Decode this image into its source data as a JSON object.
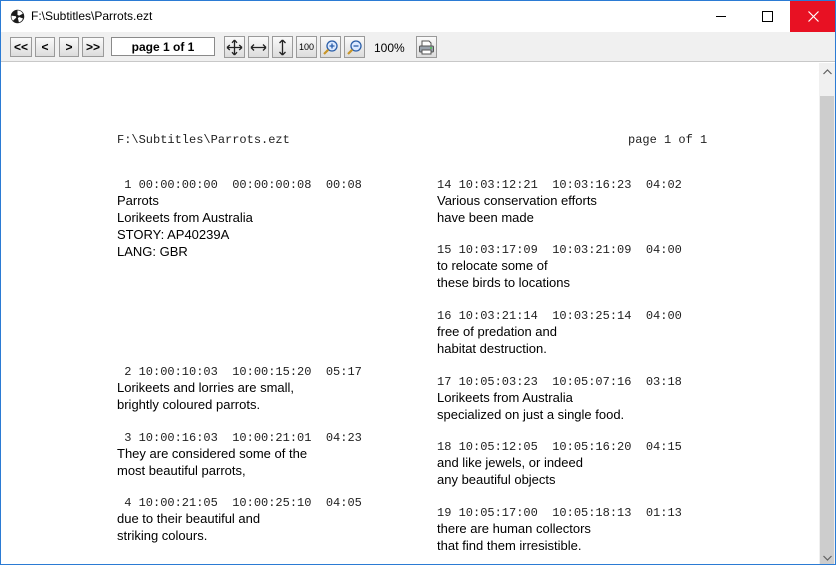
{
  "window": {
    "title": "F:\\Subtitles\\Parrots.ezt"
  },
  "toolbar": {
    "first_label": "<<",
    "prev_label": "<",
    "next_label": ">",
    "last_label": ">>",
    "page_indicator": "page 1 of 1",
    "hundred_label": "100",
    "zoom_level": "100%"
  },
  "document": {
    "header_path": "F:\\Subtitles\\Parrots.ezt",
    "header_page": "page 1 of 1",
    "left_column": [
      {
        "timecode": " 1 00:00:00:00  00:00:00:08  00:08",
        "lines": [
          "Parrots",
          "Lorikeets from Australia",
          "STORY: AP40239A",
          "LANG: GBR"
        ]
      },
      {
        "timecode": " 2 10:00:10:03  10:00:15:20  05:17",
        "lines": [
          "Lorikeets and lorries are small,",
          "brightly coloured parrots."
        ]
      },
      {
        "timecode": " 3 10:00:16:03  10:00:21:01  04:23",
        "lines": [
          "They are considered some of the",
          "most beautiful parrots,"
        ]
      },
      {
        "timecode": " 4 10:00:21:05  10:00:25:10  04:05",
        "lines": [
          "due to their beautiful and",
          "striking colours."
        ]
      }
    ],
    "right_column": [
      {
        "timecode": "14 10:03:12:21  10:03:16:23  04:02",
        "lines": [
          "Various conservation efforts",
          "have been made"
        ]
      },
      {
        "timecode": "15 10:03:17:09  10:03:21:09  04:00",
        "lines": [
          "to relocate some of",
          "these birds to locations"
        ]
      },
      {
        "timecode": "16 10:03:21:14  10:03:25:14  04:00",
        "lines": [
          "free of predation and",
          "habitat destruction."
        ]
      },
      {
        "timecode": "17 10:05:03:23  10:05:07:16  03:18",
        "lines": [
          "Lorikeets from Australia",
          "specialized on just a single food."
        ]
      },
      {
        "timecode": "18 10:05:12:05  10:05:16:20  04:15",
        "lines": [
          "and like jewels, or indeed",
          "any beautiful objects"
        ]
      },
      {
        "timecode": "19 10:05:17:00  10:05:18:13  01:13",
        "lines": [
          "there are human collectors",
          "that find them irresistible."
        ]
      }
    ]
  }
}
